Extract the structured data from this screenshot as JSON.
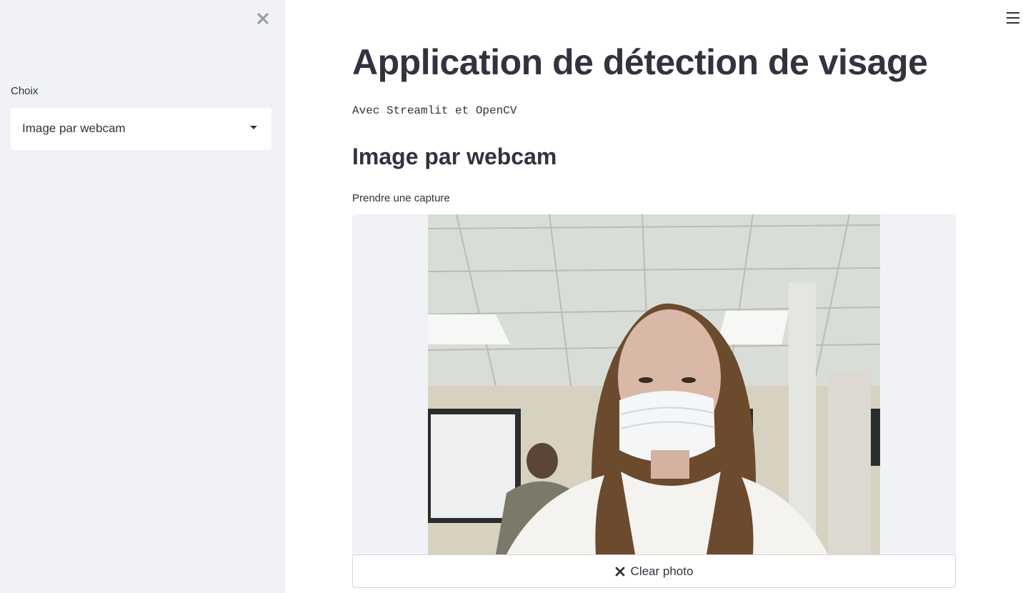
{
  "sidebar": {
    "select_label": "Choix",
    "select_value": "Image par webcam",
    "close_icon": "close-icon"
  },
  "header": {
    "menu_icon": "hamburger-menu-icon"
  },
  "main": {
    "title": "Application de détection de visage",
    "subtitle": "Avec Streamlit et OpenCV",
    "section_title": "Image par webcam",
    "camera_label": "Prendre une capture",
    "clear_button_label": "Clear photo",
    "clear_icon": "close-icon"
  },
  "colors": {
    "sidebar_bg": "#f0f2f6",
    "text": "#31333f",
    "main_bg": "#ffffff"
  }
}
